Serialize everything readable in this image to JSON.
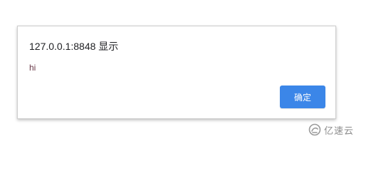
{
  "dialog": {
    "title": "127.0.0.1:8848 显示",
    "message": "hi",
    "ok_label": "确定",
    "ok_color": "#3b86e8"
  },
  "watermark": {
    "text": "亿速云",
    "logo_icon": "yisu-cloud-logo-icon"
  }
}
